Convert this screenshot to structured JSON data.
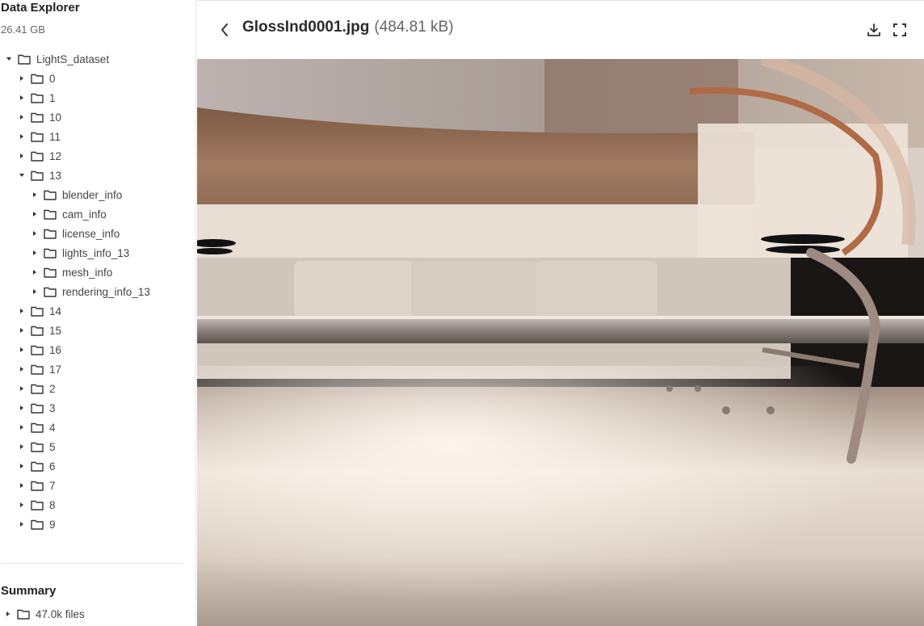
{
  "sidebar": {
    "title": "Data Explorer",
    "size": "26.41 GB",
    "tree": [
      {
        "label": "LightS_dataset",
        "depth": 0,
        "expanded": true
      },
      {
        "label": "0",
        "depth": 1,
        "expanded": false
      },
      {
        "label": "1",
        "depth": 1,
        "expanded": false
      },
      {
        "label": "10",
        "depth": 1,
        "expanded": false
      },
      {
        "label": "11",
        "depth": 1,
        "expanded": false
      },
      {
        "label": "12",
        "depth": 1,
        "expanded": false
      },
      {
        "label": "13",
        "depth": 1,
        "expanded": true
      },
      {
        "label": "blender_info",
        "depth": 2,
        "expanded": false
      },
      {
        "label": "cam_info",
        "depth": 2,
        "expanded": false
      },
      {
        "label": "license_info",
        "depth": 2,
        "expanded": false
      },
      {
        "label": "lights_info_13",
        "depth": 2,
        "expanded": false
      },
      {
        "label": "mesh_info",
        "depth": 2,
        "expanded": false
      },
      {
        "label": "rendering_info_13",
        "depth": 2,
        "expanded": false
      },
      {
        "label": "14",
        "depth": 1,
        "expanded": false
      },
      {
        "label": "15",
        "depth": 1,
        "expanded": false
      },
      {
        "label": "16",
        "depth": 1,
        "expanded": false
      },
      {
        "label": "17",
        "depth": 1,
        "expanded": false
      },
      {
        "label": "2",
        "depth": 1,
        "expanded": false
      },
      {
        "label": "3",
        "depth": 1,
        "expanded": false
      },
      {
        "label": "4",
        "depth": 1,
        "expanded": false
      },
      {
        "label": "5",
        "depth": 1,
        "expanded": false
      },
      {
        "label": "6",
        "depth": 1,
        "expanded": false
      },
      {
        "label": "7",
        "depth": 1,
        "expanded": false
      },
      {
        "label": "8",
        "depth": 1,
        "expanded": false
      },
      {
        "label": "9",
        "depth": 1,
        "expanded": false
      }
    ]
  },
  "summary": {
    "title": "Summary",
    "item_label": "47.0k files"
  },
  "viewer": {
    "file_name": "GlossInd0001.jpg",
    "file_size": "(484.81 kB)",
    "icons": {
      "back": "chevron-left-icon",
      "download": "download-icon",
      "fullscreen": "fullscreen-icon"
    }
  }
}
